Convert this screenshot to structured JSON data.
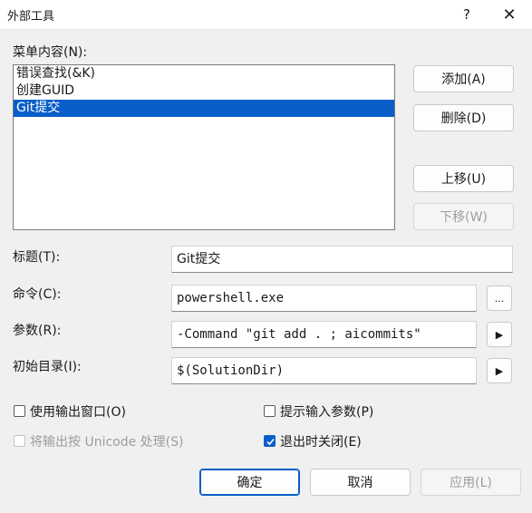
{
  "window": {
    "title": "外部工具",
    "help": "?",
    "close": "✕"
  },
  "menu_contents_label": "菜单内容(N):",
  "menu_items": [
    {
      "label": "错误查找(&K)"
    },
    {
      "label": "创建GUID"
    },
    {
      "label": "Git提交",
      "selected": true
    }
  ],
  "buttons": {
    "add": "添加(A)",
    "delete": "删除(D)",
    "move_up": "上移(U)",
    "move_down": "下移(W)",
    "ok": "确定",
    "cancel": "取消",
    "apply": "应用(L)",
    "browse": "...",
    "args_arrow": "▶",
    "dir_arrow": "▶"
  },
  "fields": {
    "title_label": "标题(T):",
    "title_value": "Git提交",
    "command_label": "命令(C):",
    "command_value": "powershell.exe",
    "arguments_label": "参数(R):",
    "arguments_value": "-Command \"git add . ; aicommits\"",
    "initial_dir_label": "初始目录(I):",
    "initial_dir_value": "$(SolutionDir)"
  },
  "options": {
    "use_output_window": {
      "label": "使用输出窗口(O)",
      "checked": false
    },
    "prompt_arguments": {
      "label": "提示输入参数(P)",
      "checked": false
    },
    "treat_output_unicode": {
      "label": "将输出按 Unicode 处理(S)",
      "checked": false,
      "disabled": true
    },
    "close_on_exit": {
      "label": "退出时关闭(E)",
      "checked": true
    }
  },
  "colors": {
    "accent": "#0a5ec9",
    "background": "#f0f0f0"
  }
}
